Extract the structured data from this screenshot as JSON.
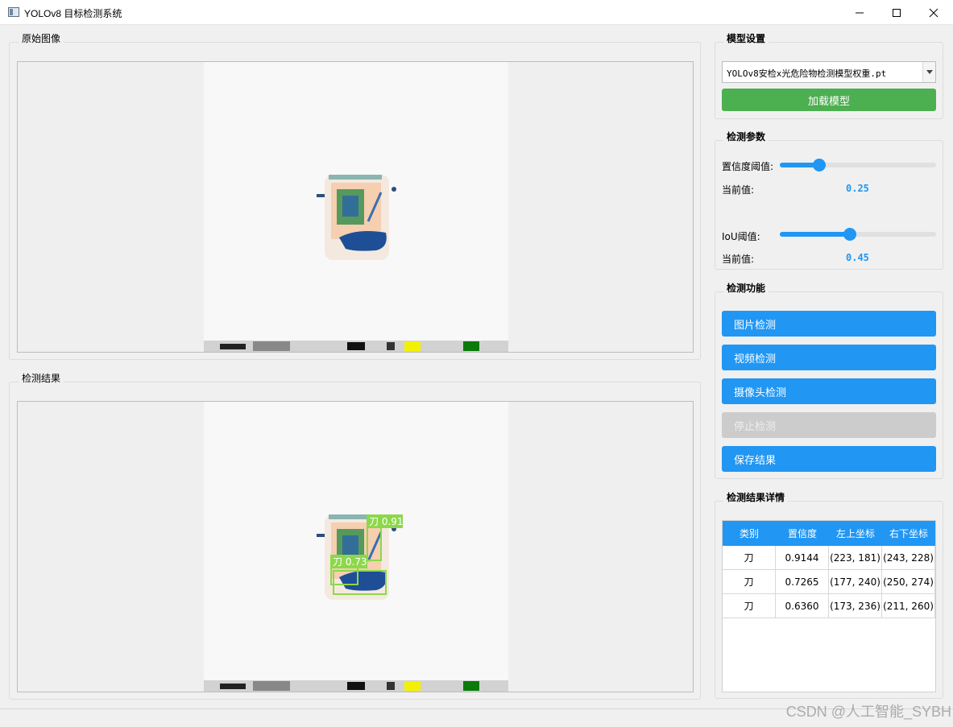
{
  "window": {
    "title": "YOLOv8 目标检测系统"
  },
  "panels": {
    "original": {
      "label": "原始图像"
    },
    "result": {
      "label": "检测结果"
    }
  },
  "model": {
    "group_label": "模型设置",
    "selected_weight": "YOLOv8安检x光危险物检测模型权重.pt",
    "load_button": "加载模型"
  },
  "params": {
    "group_label": "检测参数",
    "confidence": {
      "label": "置信度阈值:",
      "value": 0.25,
      "value_text": "0.25",
      "current_label": "当前值:"
    },
    "iou": {
      "label": "IoU阈值:",
      "value": 0.45,
      "value_text": "0.45",
      "current_label": "当前值:"
    }
  },
  "functions": {
    "group_label": "检测功能",
    "buttons": [
      {
        "label": "图片检测",
        "enabled": true
      },
      {
        "label": "视频检测",
        "enabled": true
      },
      {
        "label": "摄像头检测",
        "enabled": true
      },
      {
        "label": "停止检测",
        "enabled": false
      },
      {
        "label": "保存结果",
        "enabled": true
      }
    ]
  },
  "details": {
    "group_label": "检测结果详情",
    "columns": [
      "类别",
      "置信度",
      "左上坐标",
      "右下坐标"
    ],
    "rows": [
      [
        "刀",
        "0.9144",
        "(223, 181)",
        "(243, 228)"
      ],
      [
        "刀",
        "0.7265",
        "(177, 240)",
        "(250, 274)"
      ],
      [
        "刀",
        "0.6360",
        "(173, 236)",
        "(211, 260)"
      ]
    ]
  },
  "detections": [
    {
      "label": "刀 0.91"
    },
    {
      "label": "刀 0.73"
    }
  ],
  "watermark": "CSDN @人工智能_SYBH",
  "colors": {
    "accent": "#2196f3",
    "load_button": "#4caf50",
    "box": "#8cd84a",
    "disabled": "#cccccc"
  }
}
